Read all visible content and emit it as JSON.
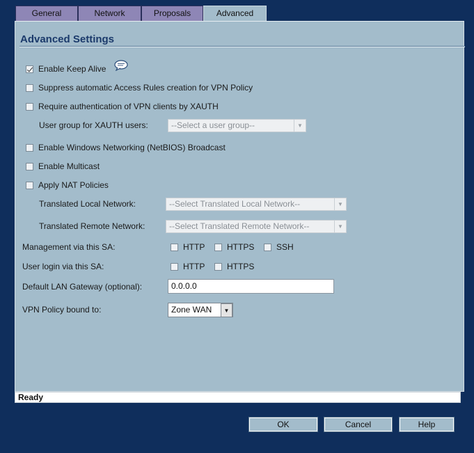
{
  "tabs": [
    {
      "label": "General",
      "active": false
    },
    {
      "label": "Network",
      "active": false
    },
    {
      "label": "Proposals",
      "active": false
    },
    {
      "label": "Advanced",
      "active": true
    }
  ],
  "panel": {
    "title": "Advanced Settings",
    "options": {
      "keep_alive": {
        "label": "Enable Keep Alive",
        "checked": true,
        "icon": "speech-bubble-icon"
      },
      "suppress_rules": {
        "label": "Suppress automatic Access Rules creation for VPN Policy",
        "checked": false
      },
      "xauth": {
        "label": "Require authentication of VPN clients by XAUTH",
        "checked": false
      },
      "netbios": {
        "label": "Enable Windows Networking (NetBIOS) Broadcast",
        "checked": false
      },
      "multicast": {
        "label": "Enable Multicast",
        "checked": false
      },
      "nat": {
        "label": "Apply NAT Policies",
        "checked": false
      }
    },
    "xauth_group": {
      "label": "User group for XAUTH users:",
      "value": "--Select a user group--"
    },
    "translated_local": {
      "label": "Translated Local Network:",
      "value": "--Select Translated Local Network--"
    },
    "translated_remote": {
      "label": "Translated Remote Network:",
      "value": "--Select Translated Remote Network--"
    },
    "management": {
      "label": "Management via this SA:",
      "http": {
        "label": "HTTP",
        "checked": false
      },
      "https": {
        "label": "HTTPS",
        "checked": false
      },
      "ssh": {
        "label": "SSH",
        "checked": false
      }
    },
    "user_login": {
      "label": "User login via this SA:",
      "http": {
        "label": "HTTP",
        "checked": false
      },
      "https": {
        "label": "HTTPS",
        "checked": false
      }
    },
    "default_gateway": {
      "label": "Default LAN Gateway (optional):",
      "value": "0.0.0.0"
    },
    "bound_to": {
      "label": "VPN Policy bound to:",
      "value": "Zone WAN"
    }
  },
  "status": {
    "text": "Ready"
  },
  "buttons": {
    "ok": "OK",
    "cancel": "Cancel",
    "help": "Help"
  },
  "colors": {
    "background": "#0f2e5c",
    "panel": "#a3bccb",
    "tab_inactive": "#8e86b6",
    "title": "#1b3a6b"
  }
}
